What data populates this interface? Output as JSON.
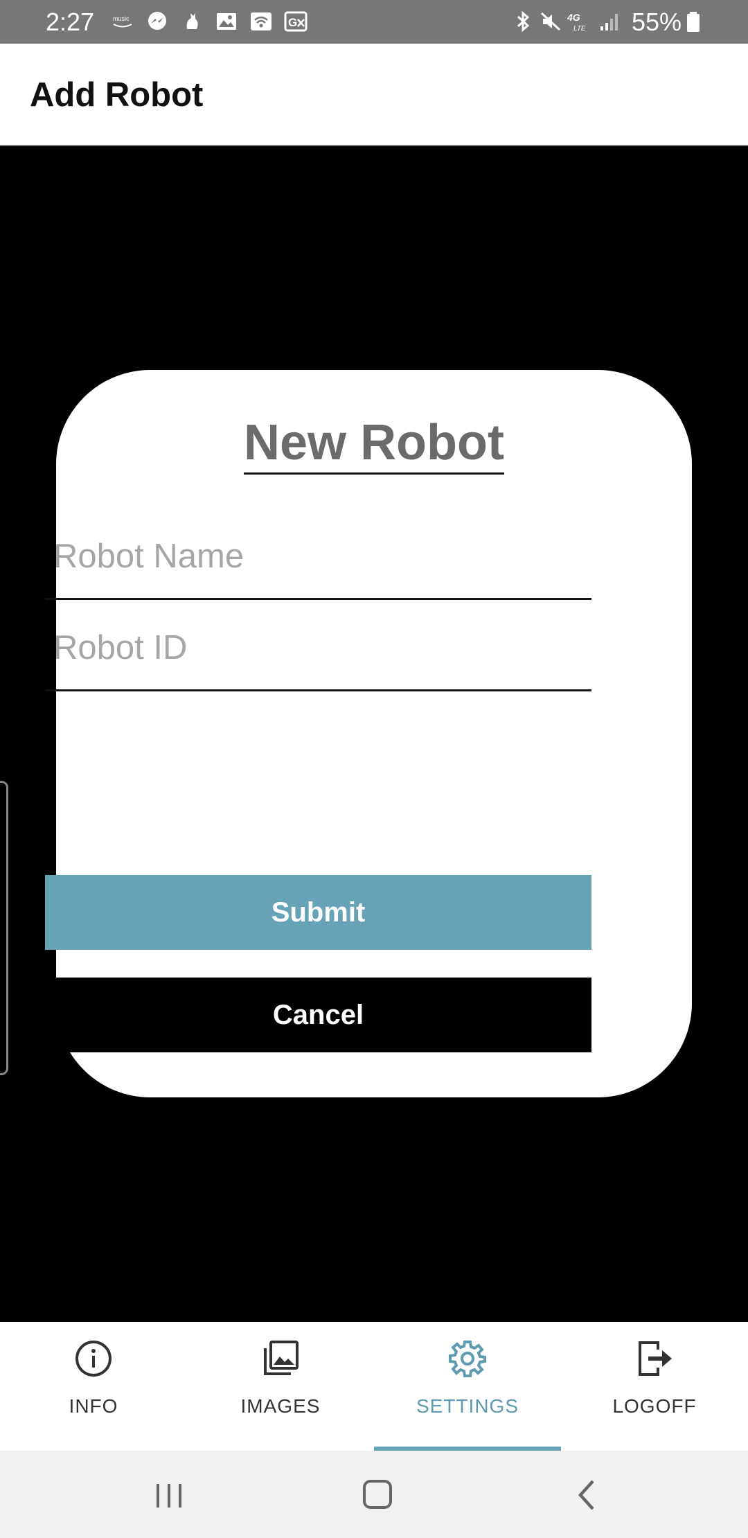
{
  "status_bar": {
    "time": "2:27",
    "battery": "55%",
    "left_icons": [
      "amazon-music-icon",
      "messenger-icon",
      "cat-notification-icon",
      "gallery-icon",
      "wifi-calling-icon",
      "translate-icon"
    ],
    "right_icons": [
      "bluetooth-icon",
      "mute-icon",
      "4g-lte-icon",
      "signal-icon",
      "battery-icon"
    ]
  },
  "header": {
    "title": "Add Robot"
  },
  "dialog": {
    "title": "New Robot",
    "robot_name": {
      "value": "",
      "placeholder": "Robot Name"
    },
    "robot_id": {
      "value": "",
      "placeholder": "Robot ID"
    },
    "submit_label": "Submit",
    "cancel_label": "Cancel"
  },
  "bottom_nav": {
    "items": [
      {
        "label": "INFO",
        "icon": "info-icon",
        "active": false
      },
      {
        "label": "IMAGES",
        "icon": "images-icon",
        "active": false
      },
      {
        "label": "SETTINGS",
        "icon": "gear-icon",
        "active": true
      },
      {
        "label": "LOGOFF",
        "icon": "logout-icon",
        "active": false
      }
    ]
  },
  "system_nav": {
    "buttons": [
      "recents-button",
      "home-button",
      "back-button"
    ]
  },
  "colors": {
    "accent": "#66a3b7",
    "active_nav": "#5e9bb0",
    "status_bar": "#777777",
    "background": "#000000",
    "card": "#ffffff"
  }
}
